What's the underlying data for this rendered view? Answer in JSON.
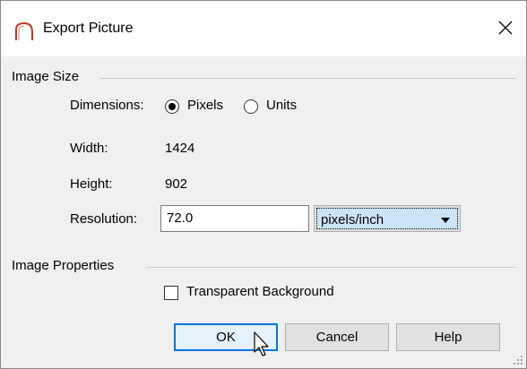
{
  "window": {
    "title": "Export Picture"
  },
  "image_size": {
    "group_label": "Image Size",
    "dimensions_label": "Dimensions:",
    "pixels_label": "Pixels",
    "units_label": "Units",
    "width_label": "Width:",
    "width_value": "1424",
    "height_label": "Height:",
    "height_value": "902",
    "resolution_label": "Resolution:",
    "resolution_value": "72.0",
    "resolution_unit": "pixels/inch"
  },
  "image_properties": {
    "group_label": "Image Properties",
    "transparent_label": "Transparent Background"
  },
  "buttons": {
    "ok": "OK",
    "cancel": "Cancel",
    "help": "Help"
  },
  "colors": {
    "accent": "#0078d7",
    "title_icon": "#c0392b"
  }
}
